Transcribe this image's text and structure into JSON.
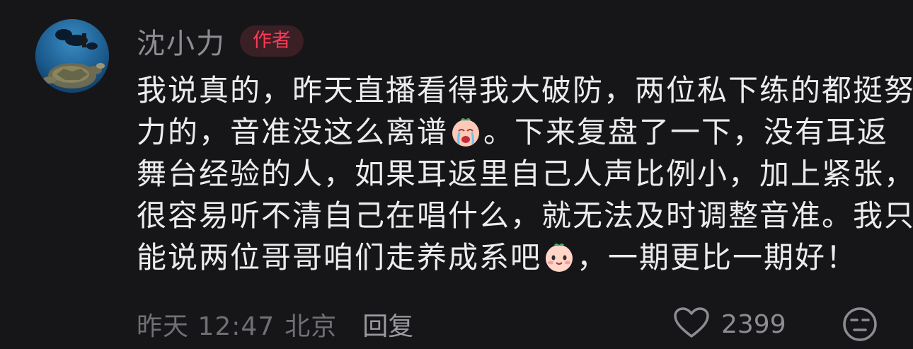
{
  "comment": {
    "author": "沈小力",
    "author_badge": "作者",
    "lines": [
      [
        "我说真的，昨天直播看得我大破防，两位私下练的都挺努"
      ],
      [
        "力的，音准没这么离谱",
        "。下来复盘了一下，没有耳返"
      ],
      [
        "舞台经验的人，如果耳返里自己人声比例小，加上紧张，"
      ],
      [
        "很容易听不清自己在唱什么，就无法及时调整音准。我只"
      ],
      [
        "能说两位哥哥咱们走养成系吧",
        "，一期更比一期好！"
      ]
    ],
    "emoji_1": "crying-face-emoji",
    "emoji_2": "smiling-face-emoji",
    "timestamp": "昨天 12:47",
    "location": "北京",
    "reply_label": "回复",
    "like_count": "2399"
  },
  "icons": {
    "like": "heart-outline-icon",
    "dislike": "unamused-face-icon"
  },
  "colors": {
    "background": "#161619",
    "badge_text": "#ff3a55",
    "badge_bg": "#3a1f25",
    "username": "#8c8c92"
  }
}
